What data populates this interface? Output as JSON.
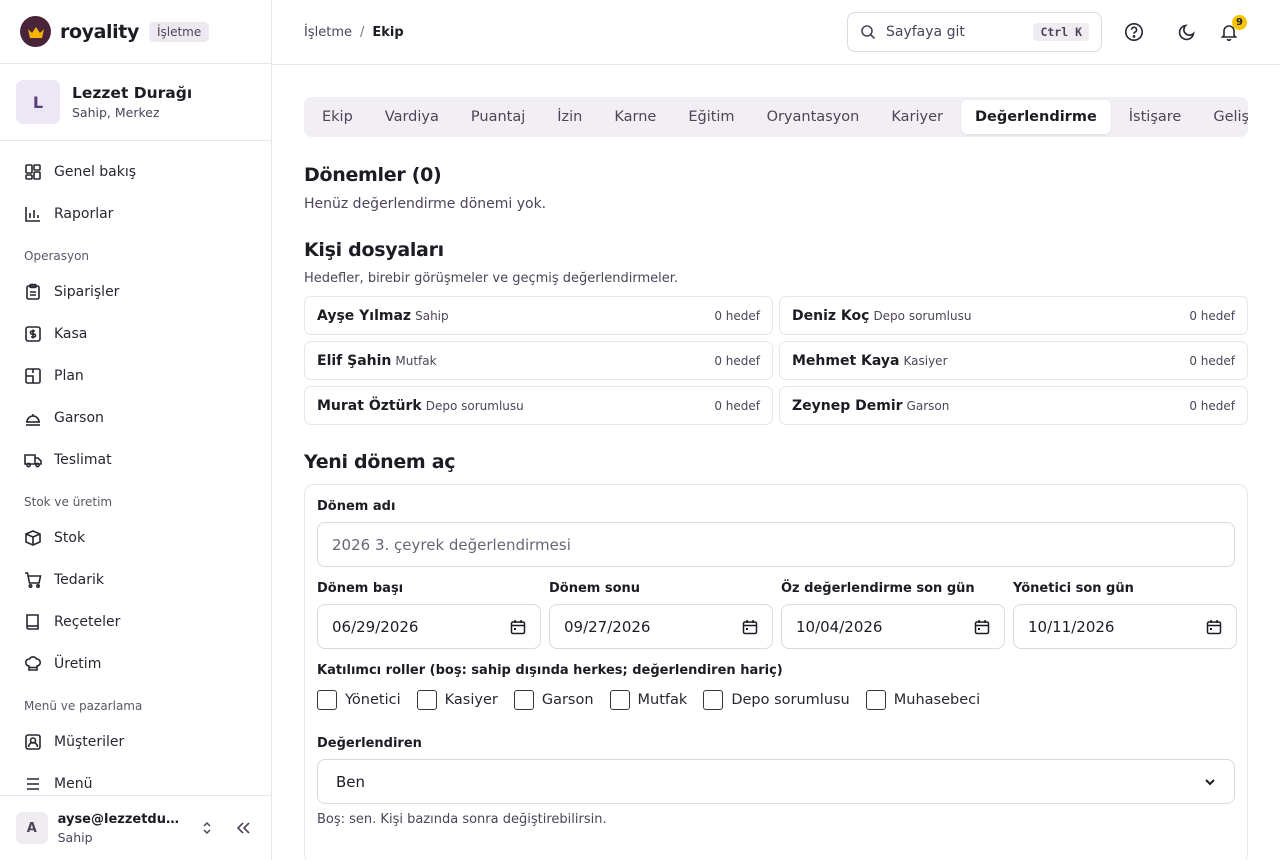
{
  "brand": {
    "name": "royality",
    "badge": "İşletme"
  },
  "business": {
    "initial": "L",
    "name": "Lezzet Durağı",
    "role": "Sahip, Merkez"
  },
  "sidebar": {
    "top_items": [
      {
        "label": "Genel bakış",
        "icon": "dashboard-icon"
      },
      {
        "label": "Raporlar",
        "icon": "bar-chart-icon"
      }
    ],
    "sections": [
      {
        "title": "Operasyon",
        "items": [
          {
            "label": "Siparişler",
            "icon": "clipboard-icon"
          },
          {
            "label": "Kasa",
            "icon": "cash-icon"
          },
          {
            "label": "Plan",
            "icon": "floor-plan-icon"
          },
          {
            "label": "Garson",
            "icon": "waiter-icon"
          },
          {
            "label": "Teslimat",
            "icon": "truck-icon"
          }
        ]
      },
      {
        "title": "Stok ve üretim",
        "items": [
          {
            "label": "Stok",
            "icon": "box-icon"
          },
          {
            "label": "Tedarik",
            "icon": "cart-icon"
          },
          {
            "label": "Reçeteler",
            "icon": "book-icon"
          },
          {
            "label": "Üretim",
            "icon": "chef-hat-icon"
          }
        ]
      },
      {
        "title": "Menü ve pazarlama",
        "items": [
          {
            "label": "Müşteriler",
            "icon": "customer-icon"
          },
          {
            "label": "Menü",
            "icon": "menu-icon"
          }
        ]
      }
    ]
  },
  "account": {
    "initial": "A",
    "email": "ayse@lezzetduragi.com",
    "role": "Sahip"
  },
  "topbar": {
    "breadcrumb": [
      "İşletme",
      "Ekip"
    ],
    "breadcrumb_sep": "/",
    "search_placeholder": "Sayfaya git",
    "shortcut": "Ctrl K",
    "notification_count": "9"
  },
  "tabs": [
    "Ekip",
    "Vardiya",
    "Puantaj",
    "İzin",
    "Karne",
    "Eğitim",
    "Oryantasyon",
    "Kariyer",
    "Değerlendirme",
    "İstişare",
    "Gelişim raporu"
  ],
  "active_tab": "Değerlendirme",
  "periods": {
    "title": "Dönemler (0)",
    "empty": "Henüz değerlendirme dönemi yok."
  },
  "people_section": {
    "title": "Kişi dosyaları",
    "subtitle": "Hedefler, birebir görüşmeler ve geçmiş değerlendirmeler.",
    "people": [
      {
        "name": "Ayşe Yılmaz",
        "role": "Sahip",
        "goals": "0 hedef"
      },
      {
        "name": "Deniz Koç",
        "role": "Depo sorumlusu",
        "goals": "0 hedef"
      },
      {
        "name": "Elif Şahin",
        "role": "Mutfak",
        "goals": "0 hedef"
      },
      {
        "name": "Mehmet Kaya",
        "role": "Kasiyer",
        "goals": "0 hedef"
      },
      {
        "name": "Murat Öztürk",
        "role": "Depo sorumlusu",
        "goals": "0 hedef"
      },
      {
        "name": "Zeynep Demir",
        "role": "Garson",
        "goals": "0 hedef"
      }
    ]
  },
  "new_period": {
    "title": "Yeni dönem aç",
    "name_label": "Dönem adı",
    "name_placeholder": "2026 3. çeyrek değerlendirmesi",
    "dates": [
      {
        "label": "Dönem başı",
        "value": "06/29/2026"
      },
      {
        "label": "Dönem sonu",
        "value": "09/27/2026"
      },
      {
        "label": "Öz değerlendirme son gün",
        "value": "10/04/2026"
      },
      {
        "label": "Yönetici son gün",
        "value": "10/11/2026"
      }
    ],
    "roles_label": "Katılımcı roller (boş: sahip dışında herkes; değerlendiren hariç)",
    "roles": [
      "Yönetici",
      "Kasiyer",
      "Garson",
      "Mutfak",
      "Depo sorumlusu",
      "Muhasebeci"
    ],
    "evaluator_label": "Değerlendiren",
    "evaluator_value": "Ben",
    "evaluator_hint": "Boş: sen. Kişi bazında sonra değiştirebilirsin."
  }
}
